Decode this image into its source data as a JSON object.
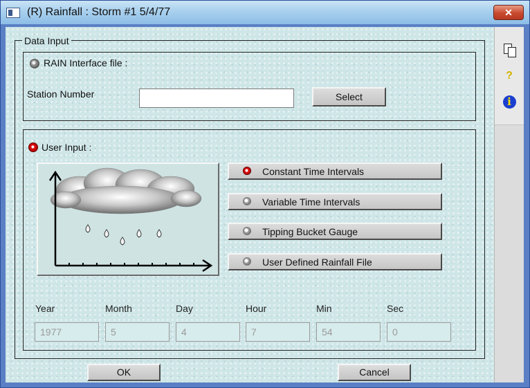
{
  "window": {
    "title": "(R) Rainfall : Storm #1 5/4/77",
    "close_label": "✕"
  },
  "sidebar": {
    "icons": [
      "copy-icon",
      "help-icon",
      "info-icon"
    ],
    "help_glyph": "?",
    "info_glyph": "i"
  },
  "data_input": {
    "legend": "Data Input",
    "rain_interface": {
      "label": "RAIN Interface file :",
      "station_label": "Station Number",
      "station_value": "",
      "select_label": "Select"
    },
    "user_input": {
      "label": "User Input :",
      "options": [
        {
          "label": "Constant Time Intervals",
          "selected": true
        },
        {
          "label": "Variable Time Intervals",
          "selected": false
        },
        {
          "label": "Tipping Bucket Gauge",
          "selected": false
        },
        {
          "label": "User Defined Rainfall File",
          "selected": false
        }
      ]
    },
    "datetime": [
      {
        "label": "Year",
        "value": "1977"
      },
      {
        "label": "Month",
        "value": "5"
      },
      {
        "label": "Day",
        "value": "4"
      },
      {
        "label": "Hour",
        "value": "7"
      },
      {
        "label": "Min",
        "value": "54"
      },
      {
        "label": "Sec",
        "value": "0"
      }
    ]
  },
  "buttons": {
    "ok": "OK",
    "cancel": "Cancel"
  },
  "colors": {
    "title_bar": "#a9d0ee",
    "panel_bg": "#cfe6e8",
    "close_button": "#c74a2e",
    "selected_radio": "#e31212"
  }
}
